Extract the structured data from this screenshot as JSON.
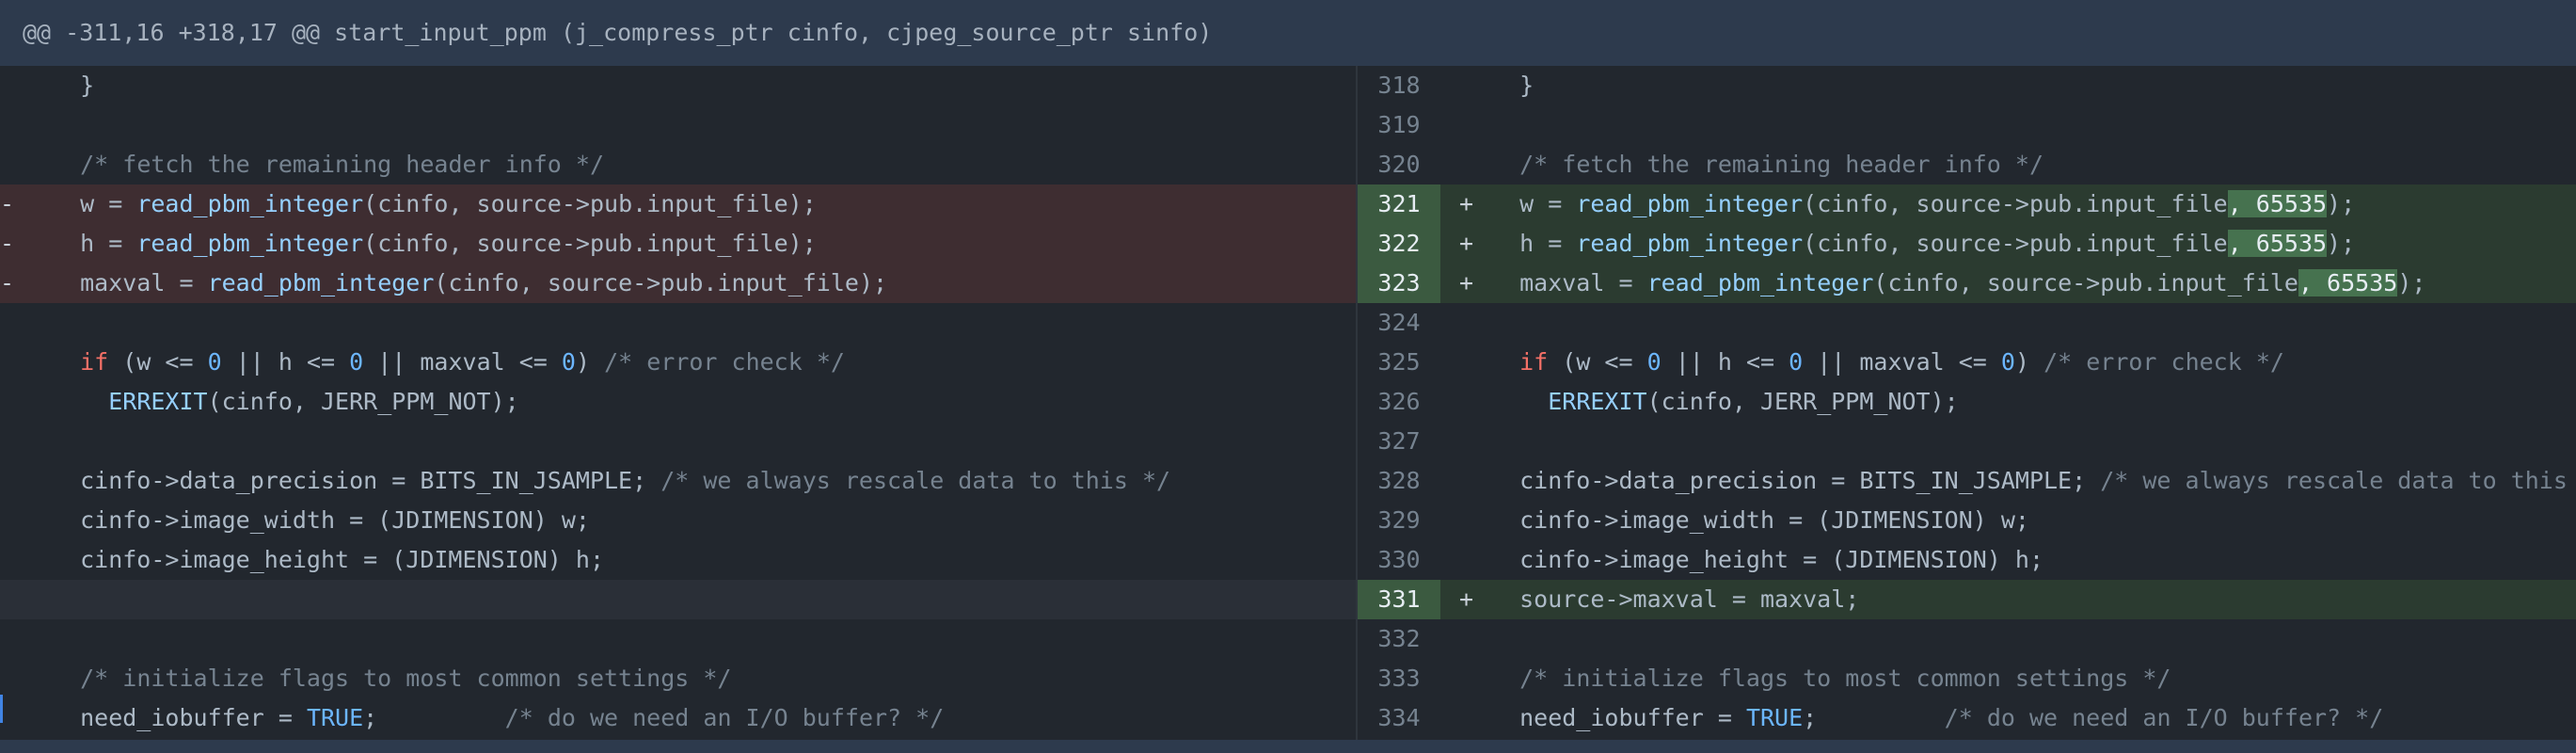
{
  "hunk_header": "@@ -311,16 +318,17 @@ start_input_ppm (j_compress_ptr cinfo, cjpeg_source_ptr sinfo)",
  "left": {
    "rows": [
      {
        "type": "ctx",
        "sign": "",
        "code": "  }"
      },
      {
        "type": "ctx",
        "sign": "",
        "code": ""
      },
      {
        "type": "ctx",
        "sign": "",
        "code": "  /* fetch the remaining header info */"
      },
      {
        "type": "del",
        "sign": "-",
        "code": "  w = read_pbm_integer(cinfo, source->pub.input_file);"
      },
      {
        "type": "del",
        "sign": "-",
        "code": "  h = read_pbm_integer(cinfo, source->pub.input_file);"
      },
      {
        "type": "del",
        "sign": "-",
        "code": "  maxval = read_pbm_integer(cinfo, source->pub.input_file);"
      },
      {
        "type": "ctx",
        "sign": "",
        "code": ""
      },
      {
        "type": "ctx",
        "sign": "",
        "code": "  if (w <= 0 || h <= 0 || maxval <= 0) /* error check */"
      },
      {
        "type": "ctx",
        "sign": "",
        "code": "    ERREXIT(cinfo, JERR_PPM_NOT);"
      },
      {
        "type": "ctx",
        "sign": "",
        "code": ""
      },
      {
        "type": "ctx",
        "sign": "",
        "code": "  cinfo->data_precision = BITS_IN_JSAMPLE; /* we always rescale data to this */"
      },
      {
        "type": "ctx",
        "sign": "",
        "code": "  cinfo->image_width = (JDIMENSION) w;"
      },
      {
        "type": "ctx",
        "sign": "",
        "code": "  cinfo->image_height = (JDIMENSION) h;"
      },
      {
        "type": "spacer",
        "sign": "",
        "code": ""
      },
      {
        "type": "ctx",
        "sign": "",
        "code": ""
      },
      {
        "type": "ctx",
        "sign": "",
        "code": "  /* initialize flags to most common settings */"
      },
      {
        "type": "ctx",
        "sign": "",
        "code": "  need_iobuffer = TRUE;         /* do we need an I/O buffer? */"
      }
    ]
  },
  "right": {
    "rows": [
      {
        "type": "ctx",
        "num": "318",
        "sign": "",
        "code": "  }"
      },
      {
        "type": "ctx",
        "num": "319",
        "sign": "",
        "code": ""
      },
      {
        "type": "ctx",
        "num": "320",
        "sign": "",
        "code": "  /* fetch the remaining header info */"
      },
      {
        "type": "add",
        "num": "321",
        "sign": "+",
        "code": "  w = read_pbm_integer(cinfo, source->pub.input_file, 65535);"
      },
      {
        "type": "add",
        "num": "322",
        "sign": "+",
        "code": "  h = read_pbm_integer(cinfo, source->pub.input_file, 65535);"
      },
      {
        "type": "add",
        "num": "323",
        "sign": "+",
        "code": "  maxval = read_pbm_integer(cinfo, source->pub.input_file, 65535);"
      },
      {
        "type": "ctx",
        "num": "324",
        "sign": "",
        "code": ""
      },
      {
        "type": "ctx",
        "num": "325",
        "sign": "",
        "code": "  if (w <= 0 || h <= 0 || maxval <= 0) /* error check */"
      },
      {
        "type": "ctx",
        "num": "326",
        "sign": "",
        "code": "    ERREXIT(cinfo, JERR_PPM_NOT);"
      },
      {
        "type": "ctx",
        "num": "327",
        "sign": "",
        "code": ""
      },
      {
        "type": "ctx",
        "num": "328",
        "sign": "",
        "code": "  cinfo->data_precision = BITS_IN_JSAMPLE; /* we always rescale data to this */"
      },
      {
        "type": "ctx",
        "num": "329",
        "sign": "",
        "code": "  cinfo->image_width = (JDIMENSION) w;"
      },
      {
        "type": "ctx",
        "num": "330",
        "sign": "",
        "code": "  cinfo->image_height = (JDIMENSION) h;"
      },
      {
        "type": "add",
        "num": "331",
        "sign": "+",
        "code": "  source->maxval = maxval;"
      },
      {
        "type": "ctx",
        "num": "332",
        "sign": "",
        "code": ""
      },
      {
        "type": "ctx",
        "num": "333",
        "sign": "",
        "code": "  /* initialize flags to most common settings */"
      },
      {
        "type": "ctx",
        "num": "334",
        "sign": "",
        "code": "  need_iobuffer = TRUE;         /* do we need an I/O buffer? */"
      }
    ]
  },
  "colors": {
    "background": "#22272e",
    "deletion_bg": "#3e2d31",
    "addition_bg": "#2b3b30",
    "addition_gutter": "#3b5a40",
    "inline_highlight": "#46724f",
    "keyword": "#f47067",
    "function": "#96d0ff",
    "number": "#6cb6ff",
    "comment": "#768390"
  }
}
